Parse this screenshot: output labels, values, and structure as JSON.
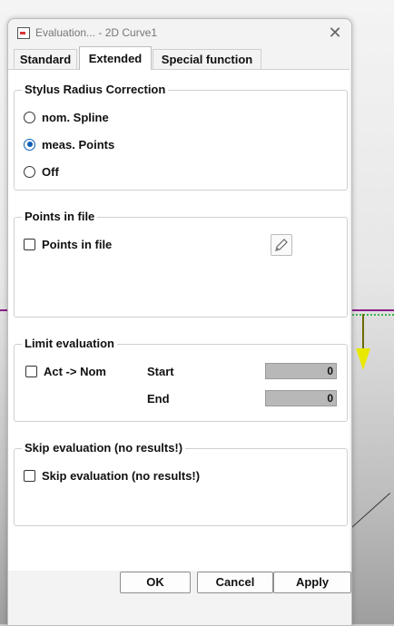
{
  "window": {
    "title": "Evaluation... - 2D Curve1",
    "close_symbol": "✕"
  },
  "tabs": [
    {
      "label": "Standard",
      "active": false
    },
    {
      "label": "Extended",
      "active": true
    },
    {
      "label": "Special function",
      "active": false
    }
  ],
  "stylus_radius_correction": {
    "title": "Stylus Radius Correction",
    "options": [
      {
        "label": "nom. Spline",
        "selected": false
      },
      {
        "label": "meas. Points",
        "selected": true
      },
      {
        "label": "Off",
        "selected": false
      }
    ]
  },
  "points_in_file": {
    "title": "Points in file",
    "checkbox_label": "Points in file",
    "checked": false,
    "edit_icon": "pencil-icon"
  },
  "limit_evaluation": {
    "title": "Limit evaluation",
    "checkbox_label": "Act -> Nom",
    "checked": false,
    "start_label": "Start",
    "start_value": "0",
    "end_label": "End",
    "end_value": "0"
  },
  "skip_evaluation": {
    "title": "Skip evaluation (no results!)",
    "checkbox_label": "Skip evaluation (no results!)",
    "checked": false
  },
  "buttons": {
    "ok": "OK",
    "cancel": "Cancel",
    "apply": "Apply"
  },
  "colors": {
    "accent": "#0a5fb8",
    "field_bg": "#b8b8b8",
    "viewport_line": "#8a1d8a",
    "arrow": "#e8e800"
  }
}
